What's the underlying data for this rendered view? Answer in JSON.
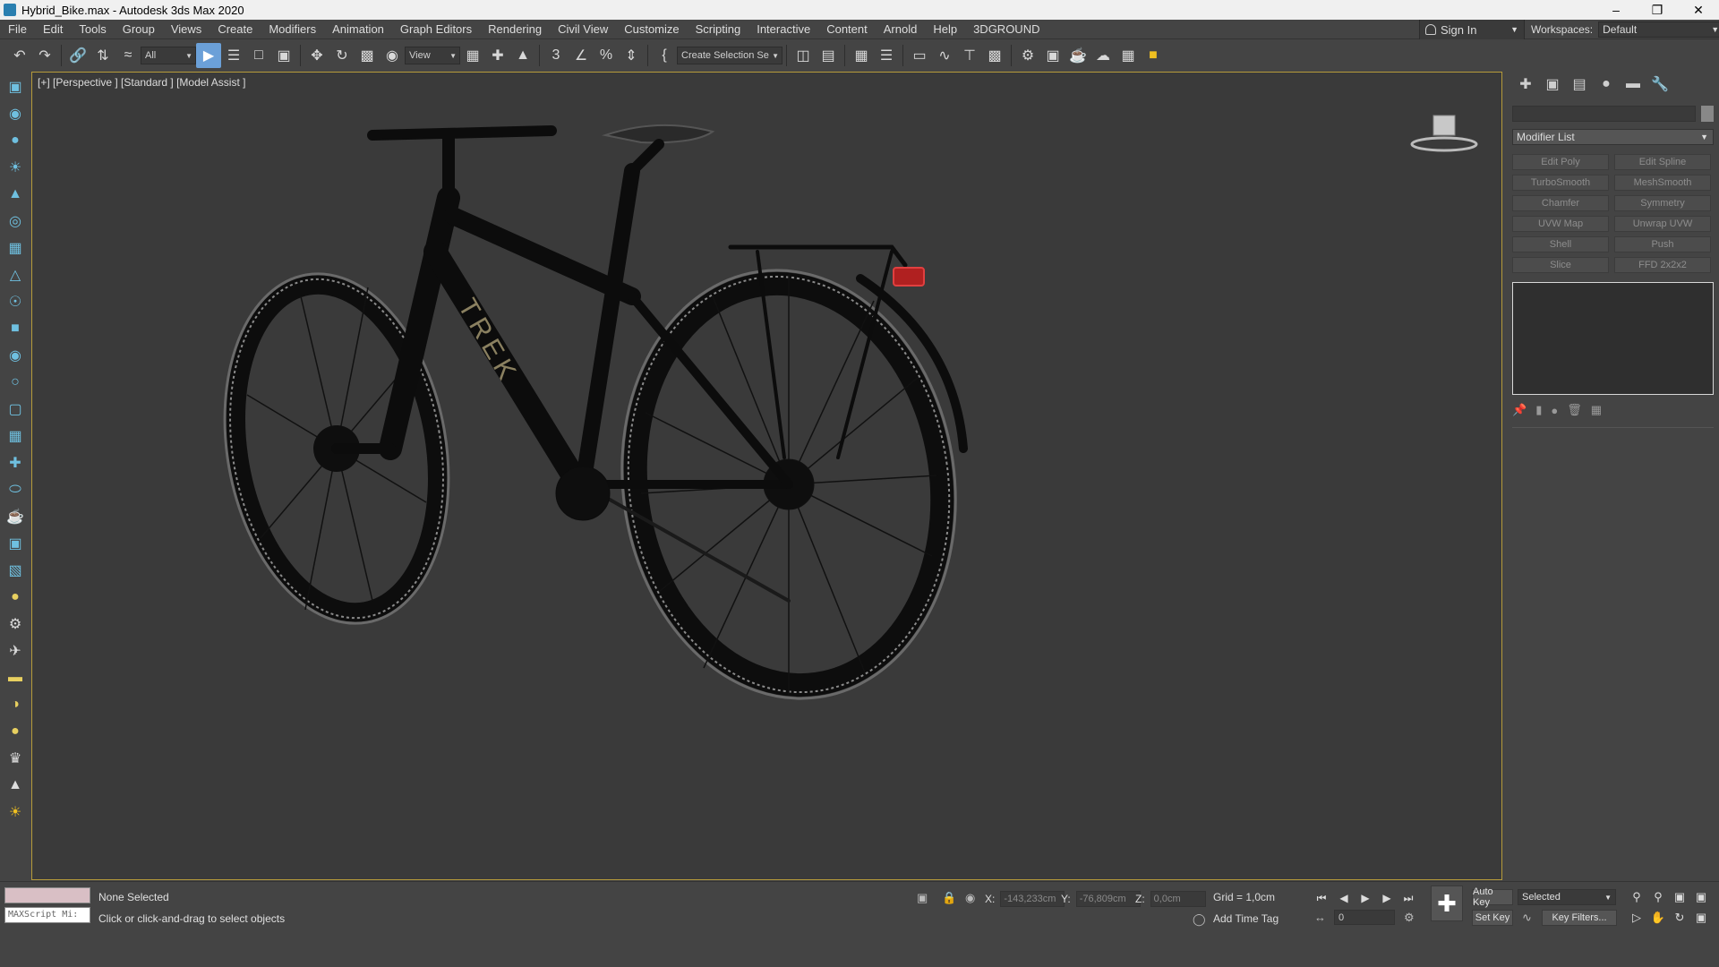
{
  "window": {
    "title": "Hybrid_Bike.max - Autodesk 3ds Max 2020"
  },
  "menu": [
    "File",
    "Edit",
    "Tools",
    "Group",
    "Views",
    "Create",
    "Modifiers",
    "Animation",
    "Graph Editors",
    "Rendering",
    "Civil View",
    "Customize",
    "Scripting",
    "Interactive",
    "Content",
    "Arnold",
    "Help",
    "3DGROUND"
  ],
  "account": {
    "sign_in": "Sign In",
    "workspaces_label": "Workspaces:",
    "workspace": "Default"
  },
  "toolbar": {
    "selection_filter": "All",
    "reference_coord": "View",
    "named_selection": "Create Selection Se"
  },
  "viewport": {
    "label": "[+] [Perspective ] [Standard ] [Model Assist ]",
    "brand_text": "TREK"
  },
  "command_panel": {
    "modifier_list": "Modifier List",
    "modifiers": [
      "Edit Poly",
      "Edit Spline",
      "TurboSmooth",
      "MeshSmooth",
      "Chamfer",
      "Symmetry",
      "UVW Map",
      "Unwrap UVW",
      "Shell",
      "Push",
      "Slice",
      "FFD 2x2x2"
    ]
  },
  "status": {
    "listener": "MAXScript Mi:",
    "selection": "None Selected",
    "prompt": "Click or click-and-drag to select objects",
    "x_label": "X:",
    "x": "-143,233cm",
    "y_label": "Y:",
    "y": "-76,809cm",
    "z_label": "Z:",
    "z": "0,0cm",
    "grid": "Grid = 1,0cm",
    "add_time_tag": "Add Time Tag",
    "frame": "0",
    "auto_key": "Auto Key",
    "set_key": "Set Key",
    "key_mode": "Selected",
    "key_filters": "Key Filters..."
  },
  "colors": {
    "accent": "#6ba0d8",
    "viewport_border": "#b59a3a",
    "viewport_bg": "#3a3a3a"
  }
}
